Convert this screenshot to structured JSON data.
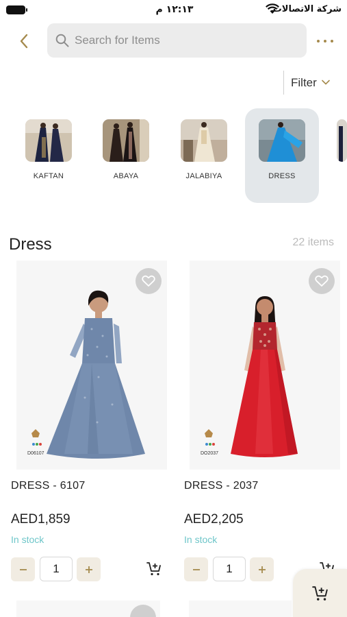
{
  "status_bar": {
    "time": "١٢:١٣ م",
    "carrier": "شركة الاتصالات"
  },
  "search": {
    "placeholder": "Search for Items",
    "value": ""
  },
  "filter": {
    "label": "Filter"
  },
  "categories": [
    {
      "label": "KAFTAN",
      "active": false
    },
    {
      "label": "ABAYA",
      "active": false
    },
    {
      "label": "JALABIYA",
      "active": false
    },
    {
      "label": "DRESS",
      "active": true
    }
  ],
  "section": {
    "title": "Dress",
    "count": "22 items"
  },
  "products": [
    {
      "name": "DRESS - 6107",
      "price": "AED1,859",
      "stock": "In stock",
      "quantity": "1",
      "image_tag": "D06107",
      "dress_color": "#6f87aa"
    },
    {
      "name": "DRESS - 2037",
      "price": "AED2,205",
      "stock": "In stock",
      "quantity": "1",
      "image_tag": "DO2037",
      "dress_color": "#d81f2b"
    }
  ],
  "colors": {
    "accent": "#a58a4d",
    "stock": "#6ec6c9",
    "active_category_bg": "#e3e7ea"
  },
  "icons": {
    "back": "chevron-left-icon",
    "search": "search-icon",
    "more": "more-horizontal-icon",
    "filter": "chevron-down-icon",
    "wishlist": "heart-icon",
    "cart": "add-to-cart-icon"
  }
}
